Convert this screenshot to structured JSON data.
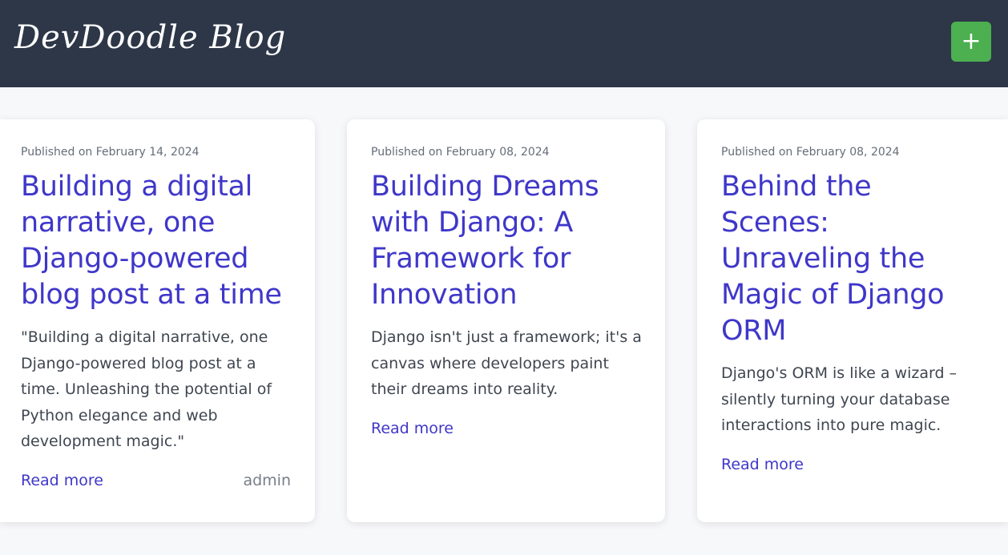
{
  "header": {
    "brand": "DevDoodle Blog",
    "add_label": "+"
  },
  "posts": [
    {
      "date": "Published on February 14, 2024",
      "title": "Building a digital narrative, one Django-powered blog post at a time",
      "excerpt": "\"Building a digital narrative, one Django-powered blog post at a time. Unleashing the potential of Python elegance and web development magic.\"",
      "read_more": "Read more",
      "author": "admin"
    },
    {
      "date": "Published on February 08, 2024",
      "title": "Building Dreams with Django: A Framework for Innovation",
      "excerpt": "Django isn't just a framework; it's a canvas where developers paint their dreams into reality.",
      "read_more": "Read more"
    },
    {
      "date": "Published on February 08, 2024",
      "title": "Behind the Scenes: Unraveling the Magic of Django ORM",
      "excerpt": "Django's ORM is like a wizard – silently turning your database interactions into pure magic.",
      "read_more": "Read more"
    }
  ],
  "colors": {
    "navbar": "#2d3748",
    "accent": "#3f37c9",
    "add_button": "#4caf50"
  }
}
